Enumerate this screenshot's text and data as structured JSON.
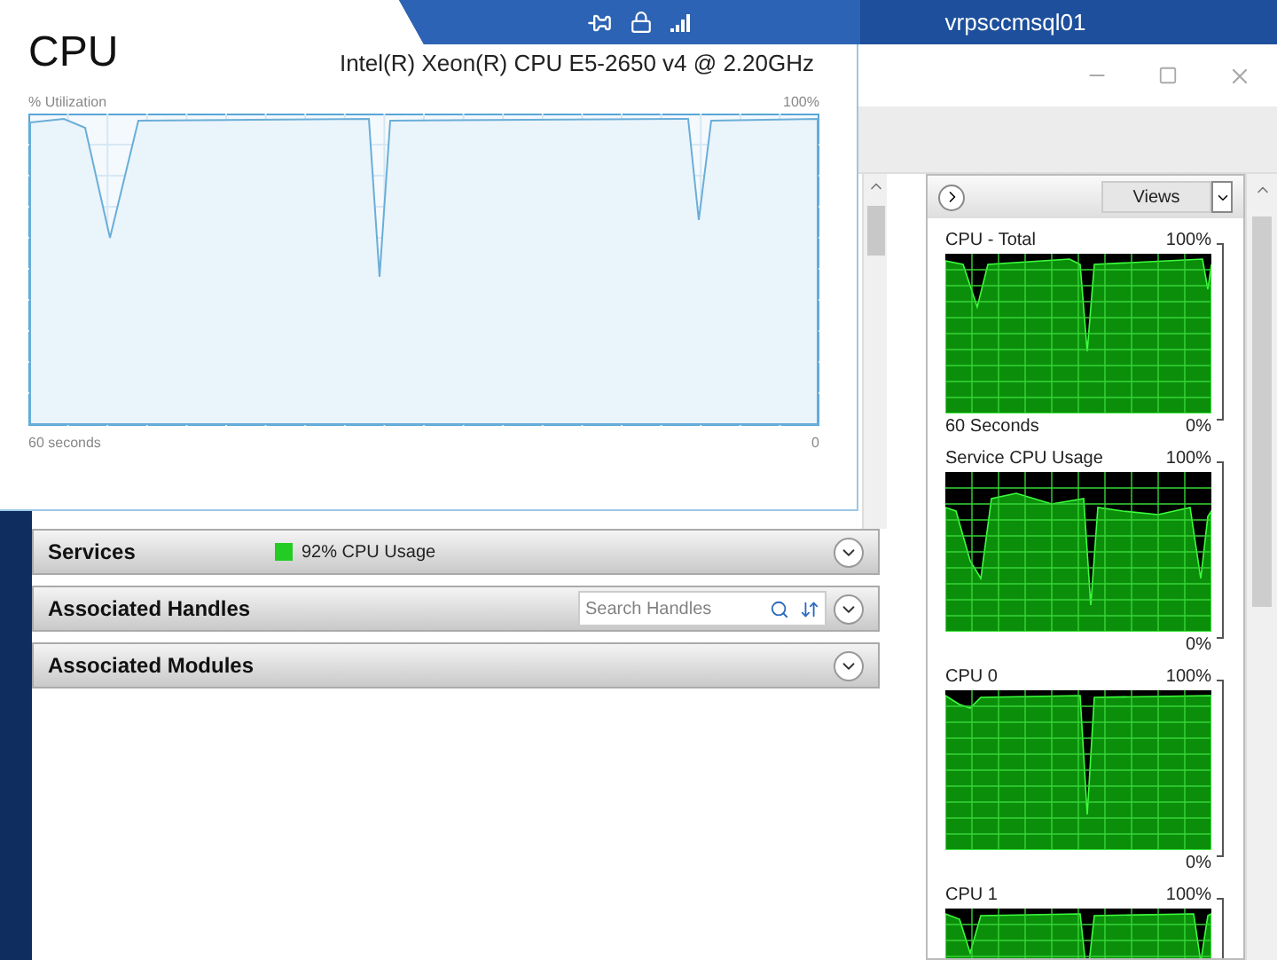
{
  "connection_bar": {
    "host": "vrpsccmsql01"
  },
  "cpu_window": {
    "title": "CPU",
    "processor": "Intel(R) Xeon(R) CPU E5-2650 v4 @ 2.20GHz",
    "y_label": "% Utilization",
    "y_max": "100%",
    "x_label": "60 seconds",
    "y_min": "0"
  },
  "panels": [
    {
      "kind": "status",
      "title": "Services",
      "status": "92% CPU Usage",
      "color": "#22cc22"
    },
    {
      "kind": "search",
      "title": "Associated Handles",
      "placeholder": "Search Handles"
    },
    {
      "kind": "plain",
      "title": "Associated Modules"
    }
  ],
  "views_button": "Views",
  "graphs": [
    {
      "title": "CPU - Total",
      "max": "100%",
      "min": "0%",
      "time": "60 Seconds"
    },
    {
      "title": "Service CPU Usage",
      "max": "100%",
      "min": "0%"
    },
    {
      "title": "CPU 0",
      "max": "100%",
      "min": "0%"
    },
    {
      "title": "CPU 1",
      "max": "100%"
    }
  ]
}
